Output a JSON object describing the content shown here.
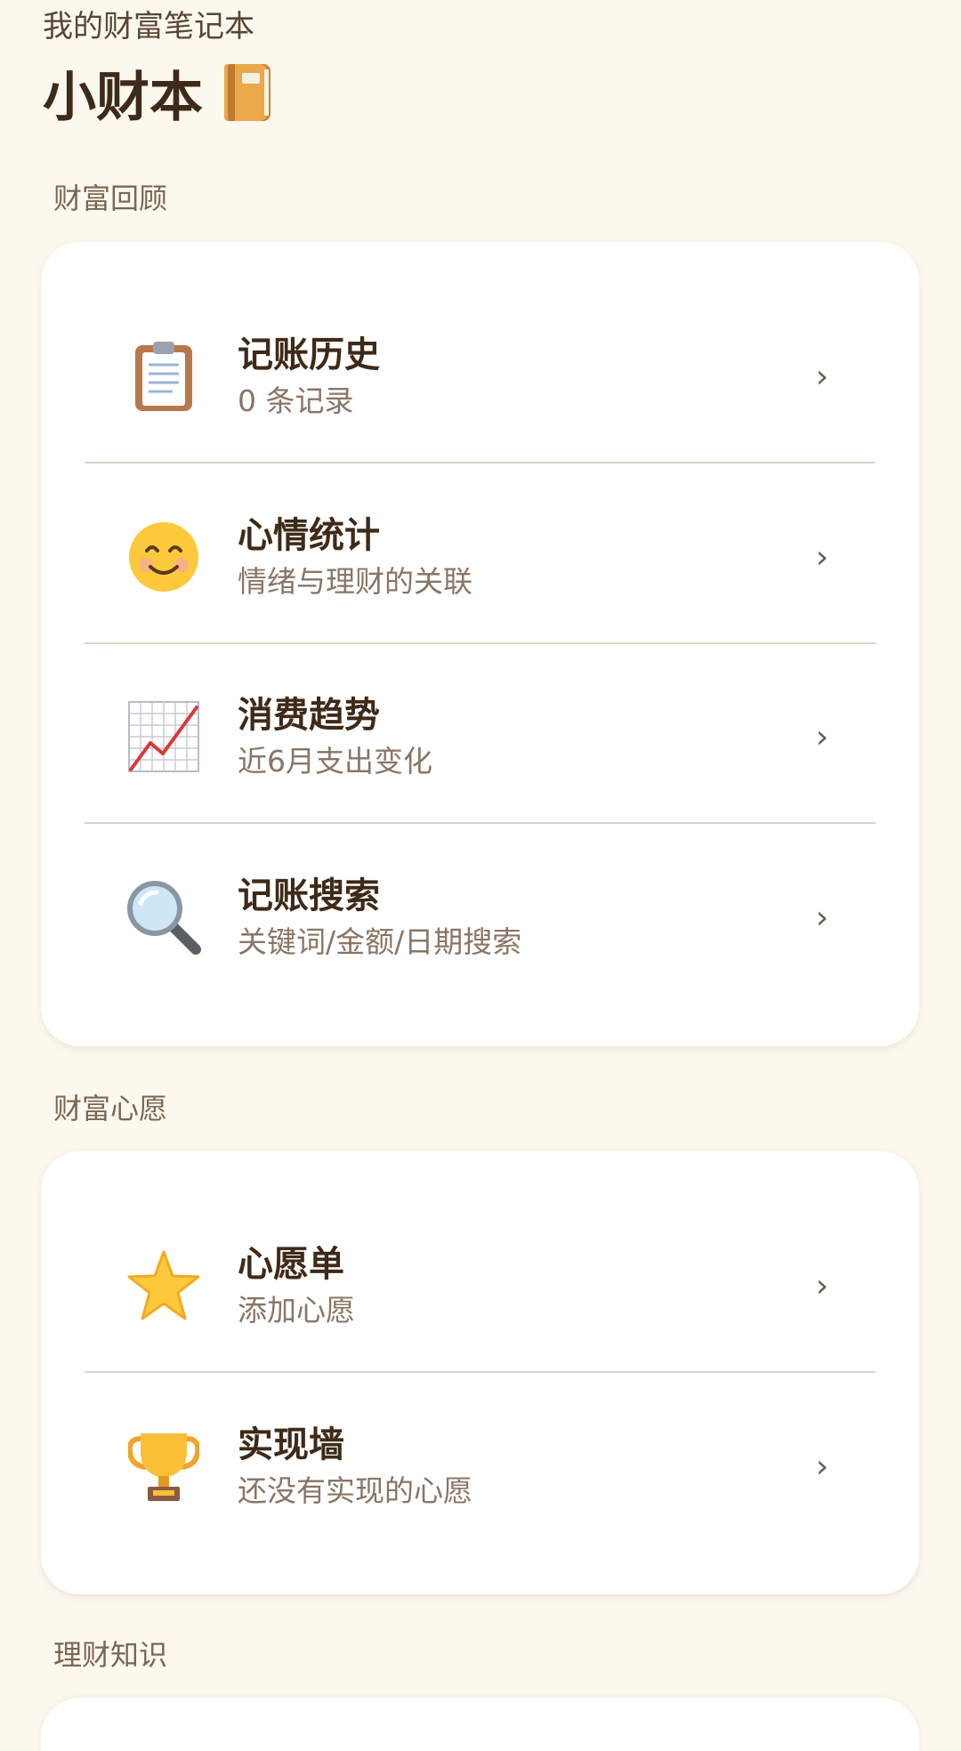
{
  "header": {
    "subtitle": "我的财富笔记本",
    "title": "小财本"
  },
  "sections": [
    {
      "heading": "财富回顾",
      "items": [
        {
          "icon": "clipboard-icon",
          "title": "记账历史",
          "subtitle": "0 条记录"
        },
        {
          "icon": "smiling-face-icon",
          "title": "心情统计",
          "subtitle": "情绪与理财的关联"
        },
        {
          "icon": "chart-increasing-icon",
          "title": "消费趋势",
          "subtitle": "近6月支出变化"
        },
        {
          "icon": "magnifying-glass-icon",
          "title": "记账搜索",
          "subtitle": "关键词/金额/日期搜索"
        }
      ]
    },
    {
      "heading": "财富心愿",
      "items": [
        {
          "icon": "star-icon",
          "title": "心愿单",
          "subtitle": "添加心愿"
        },
        {
          "icon": "trophy-icon",
          "title": "实现墙",
          "subtitle": "还没有实现的心愿"
        }
      ]
    },
    {
      "heading": "理财知识",
      "items": []
    }
  ],
  "colors": {
    "background": "#fcf8ee",
    "card": "#ffffff",
    "title_text": "#3e2a18",
    "subtitle_text": "#8a7565",
    "section_heading": "#7a6655",
    "divider": "#ddd2c6"
  }
}
